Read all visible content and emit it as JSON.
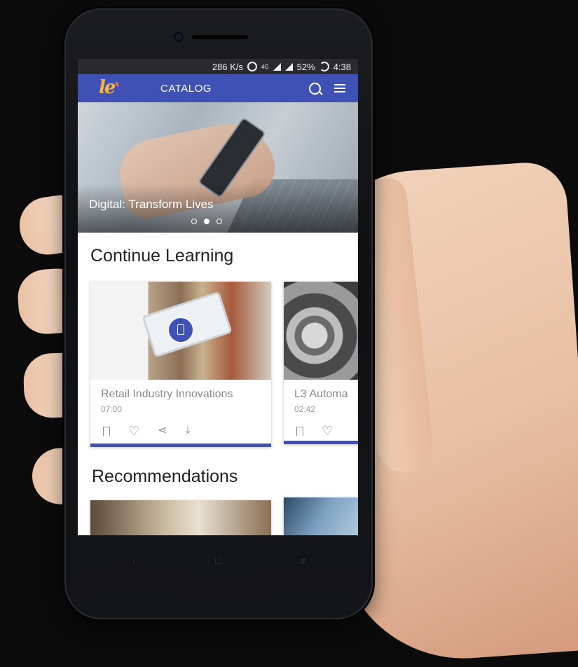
{
  "status_bar": {
    "speed": "286 K/s",
    "network": "4G",
    "battery": "52%",
    "time": "4:38"
  },
  "app_bar": {
    "logo": "le",
    "logo_mark": "x",
    "title": "CATALOG"
  },
  "hero": {
    "title": "Digital: Transform Lives",
    "slide_count": 3,
    "active_slide": 2
  },
  "continue_learning": {
    "title": "Continue Learning",
    "cards": [
      {
        "title": "Retail Industry Innovations",
        "duration": "07:00",
        "progress": 1.0
      },
      {
        "title": "L3 Automa",
        "duration": "02:42",
        "progress": 1.0
      }
    ]
  },
  "recommendations": {
    "title": "Recommendations"
  },
  "colors": {
    "primary": "#3f51b5",
    "accent": "#f6b73c",
    "progress_track": "#c5cae9"
  },
  "icons": [
    "search-icon",
    "menu-icon",
    "bookmark-icon",
    "heart-icon",
    "share-icon",
    "download-icon",
    "alarm-icon",
    "signal-icon",
    "battery-icon"
  ]
}
